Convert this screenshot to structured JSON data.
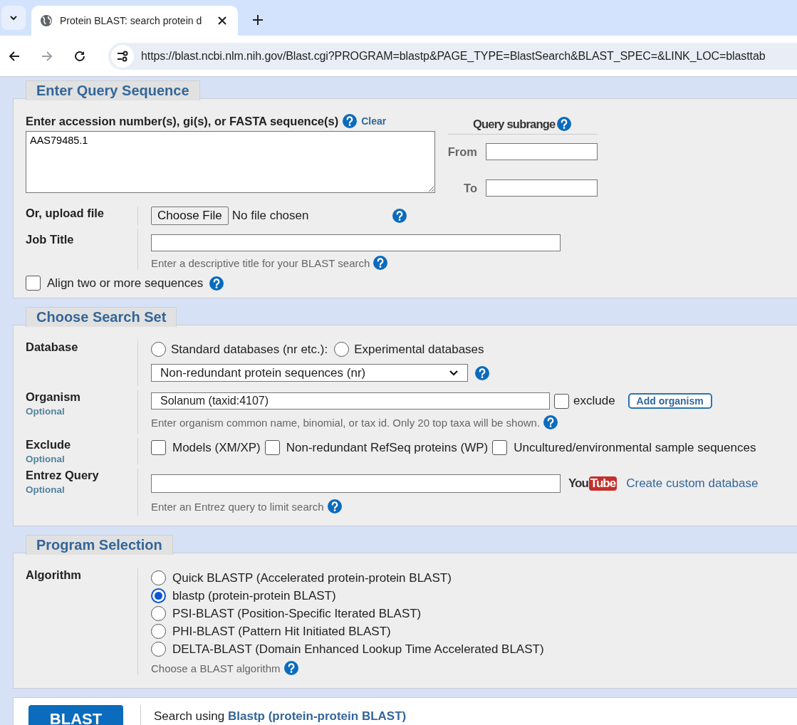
{
  "browser": {
    "tab_title": "Protein BLAST: search protein d",
    "url": "https://blast.ncbi.nlm.nih.gov/Blast.cgi?PROGRAM=blastp&PAGE_TYPE=BlastSearch&BLAST_SPEC=&LINK_LOC=blasttab"
  },
  "query": {
    "title": "Enter Query Sequence",
    "input_label": "Enter accession number(s), gi(s), or FASTA sequence(s)",
    "clear_link": "Clear",
    "sequence": "AAS79485.1",
    "subrange": {
      "title": "Query subrange",
      "from_label": "From",
      "to_label": "To"
    },
    "upload": {
      "label": "Or, upload file",
      "button": "Choose File",
      "status": "No file chosen"
    },
    "job_title": {
      "label": "Job Title",
      "hint": "Enter a descriptive title for your BLAST search"
    },
    "align": {
      "label": "Align two or more sequences",
      "checked": false
    }
  },
  "search_set": {
    "title": "Choose Search Set",
    "database": {
      "label": "Database",
      "options": [
        {
          "label": "Standard databases (nr etc.):",
          "selected": false
        },
        {
          "label": "Experimental databases",
          "selected": false
        }
      ],
      "select_value": "Non-redundant protein sequences (nr)"
    },
    "organism": {
      "label": "Organism",
      "optional": "Optional",
      "value": "Solanum (taxid:4107)",
      "exclude_label": "exclude",
      "exclude_checked": false,
      "add_button": "Add organism",
      "hint": "Enter organism common name, binomial, or tax id. Only 20 top taxa will be shown."
    },
    "exclude": {
      "label": "Exclude",
      "optional": "Optional",
      "options": [
        {
          "label": "Models (XM/XP)",
          "checked": false
        },
        {
          "label": "Non-redundant RefSeq proteins (WP)",
          "checked": false
        },
        {
          "label": "Uncultured/environmental sample sequences",
          "checked": false
        }
      ]
    },
    "entrez": {
      "label": "Entrez Query",
      "optional": "Optional",
      "logo": [
        "You",
        "Tube"
      ],
      "link": "Create custom database",
      "hint": "Enter an Entrez query to limit search"
    }
  },
  "program": {
    "title": "Program Selection",
    "label": "Algorithm",
    "options": [
      {
        "label": "Quick BLASTP (Accelerated protein-protein BLAST)",
        "selected": false
      },
      {
        "label": "blastp (protein-protein BLAST)",
        "selected": true
      },
      {
        "label": "PSI-BLAST (Position-Specific Iterated BLAST)",
        "selected": false
      },
      {
        "label": "PHI-BLAST (Pattern Hit Initiated BLAST)",
        "selected": false
      },
      {
        "label": "DELTA-BLAST (Domain Enhanced Lookup Time Accelerated BLAST)",
        "selected": false
      }
    ],
    "hint": "Choose a BLAST algorithm"
  },
  "submit": {
    "button": "BLAST",
    "text": "Search using",
    "program": "Blastp (protein-protein BLAST)"
  }
}
